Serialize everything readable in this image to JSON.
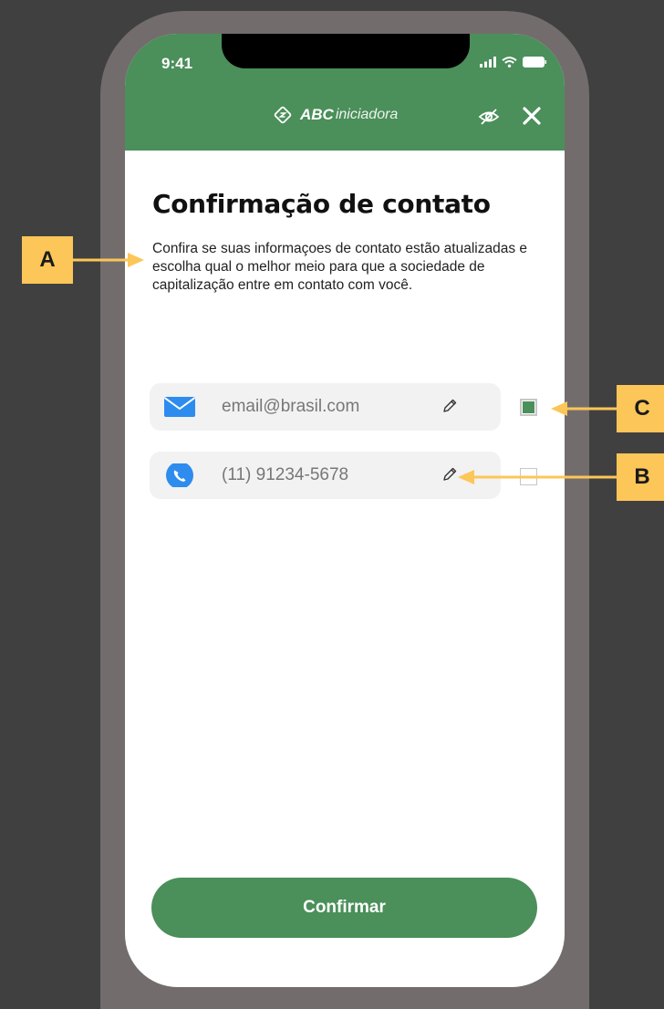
{
  "status_bar": {
    "time": "9:41"
  },
  "header": {
    "brand_bold": "ABC",
    "brand_regular": "iniciadora",
    "icons": {
      "logo": "abc-logo-icon",
      "hide": "eye-slash-icon",
      "close": "close-icon"
    }
  },
  "content": {
    "title": "Confirmação de contato",
    "description": "Confira se suas informaçoes de contato estão atualizadas e escolha qual o melhor meio para que a sociedade de capitalização entre em contato com você."
  },
  "contacts": [
    {
      "type": "email",
      "icon": "mail-icon",
      "value": "email@brasil.com",
      "selected": true
    },
    {
      "type": "phone",
      "icon": "phone-icon",
      "value": "(11) 91234-5678",
      "selected": false
    }
  ],
  "confirm_label": "Confirmar",
  "callouts": {
    "a": "A",
    "b": "B",
    "c": "C"
  },
  "colors": {
    "brand_green": "#4b8f5a",
    "callout_yellow": "#fcc658",
    "background": "#404040",
    "frame": "#726d6c"
  }
}
